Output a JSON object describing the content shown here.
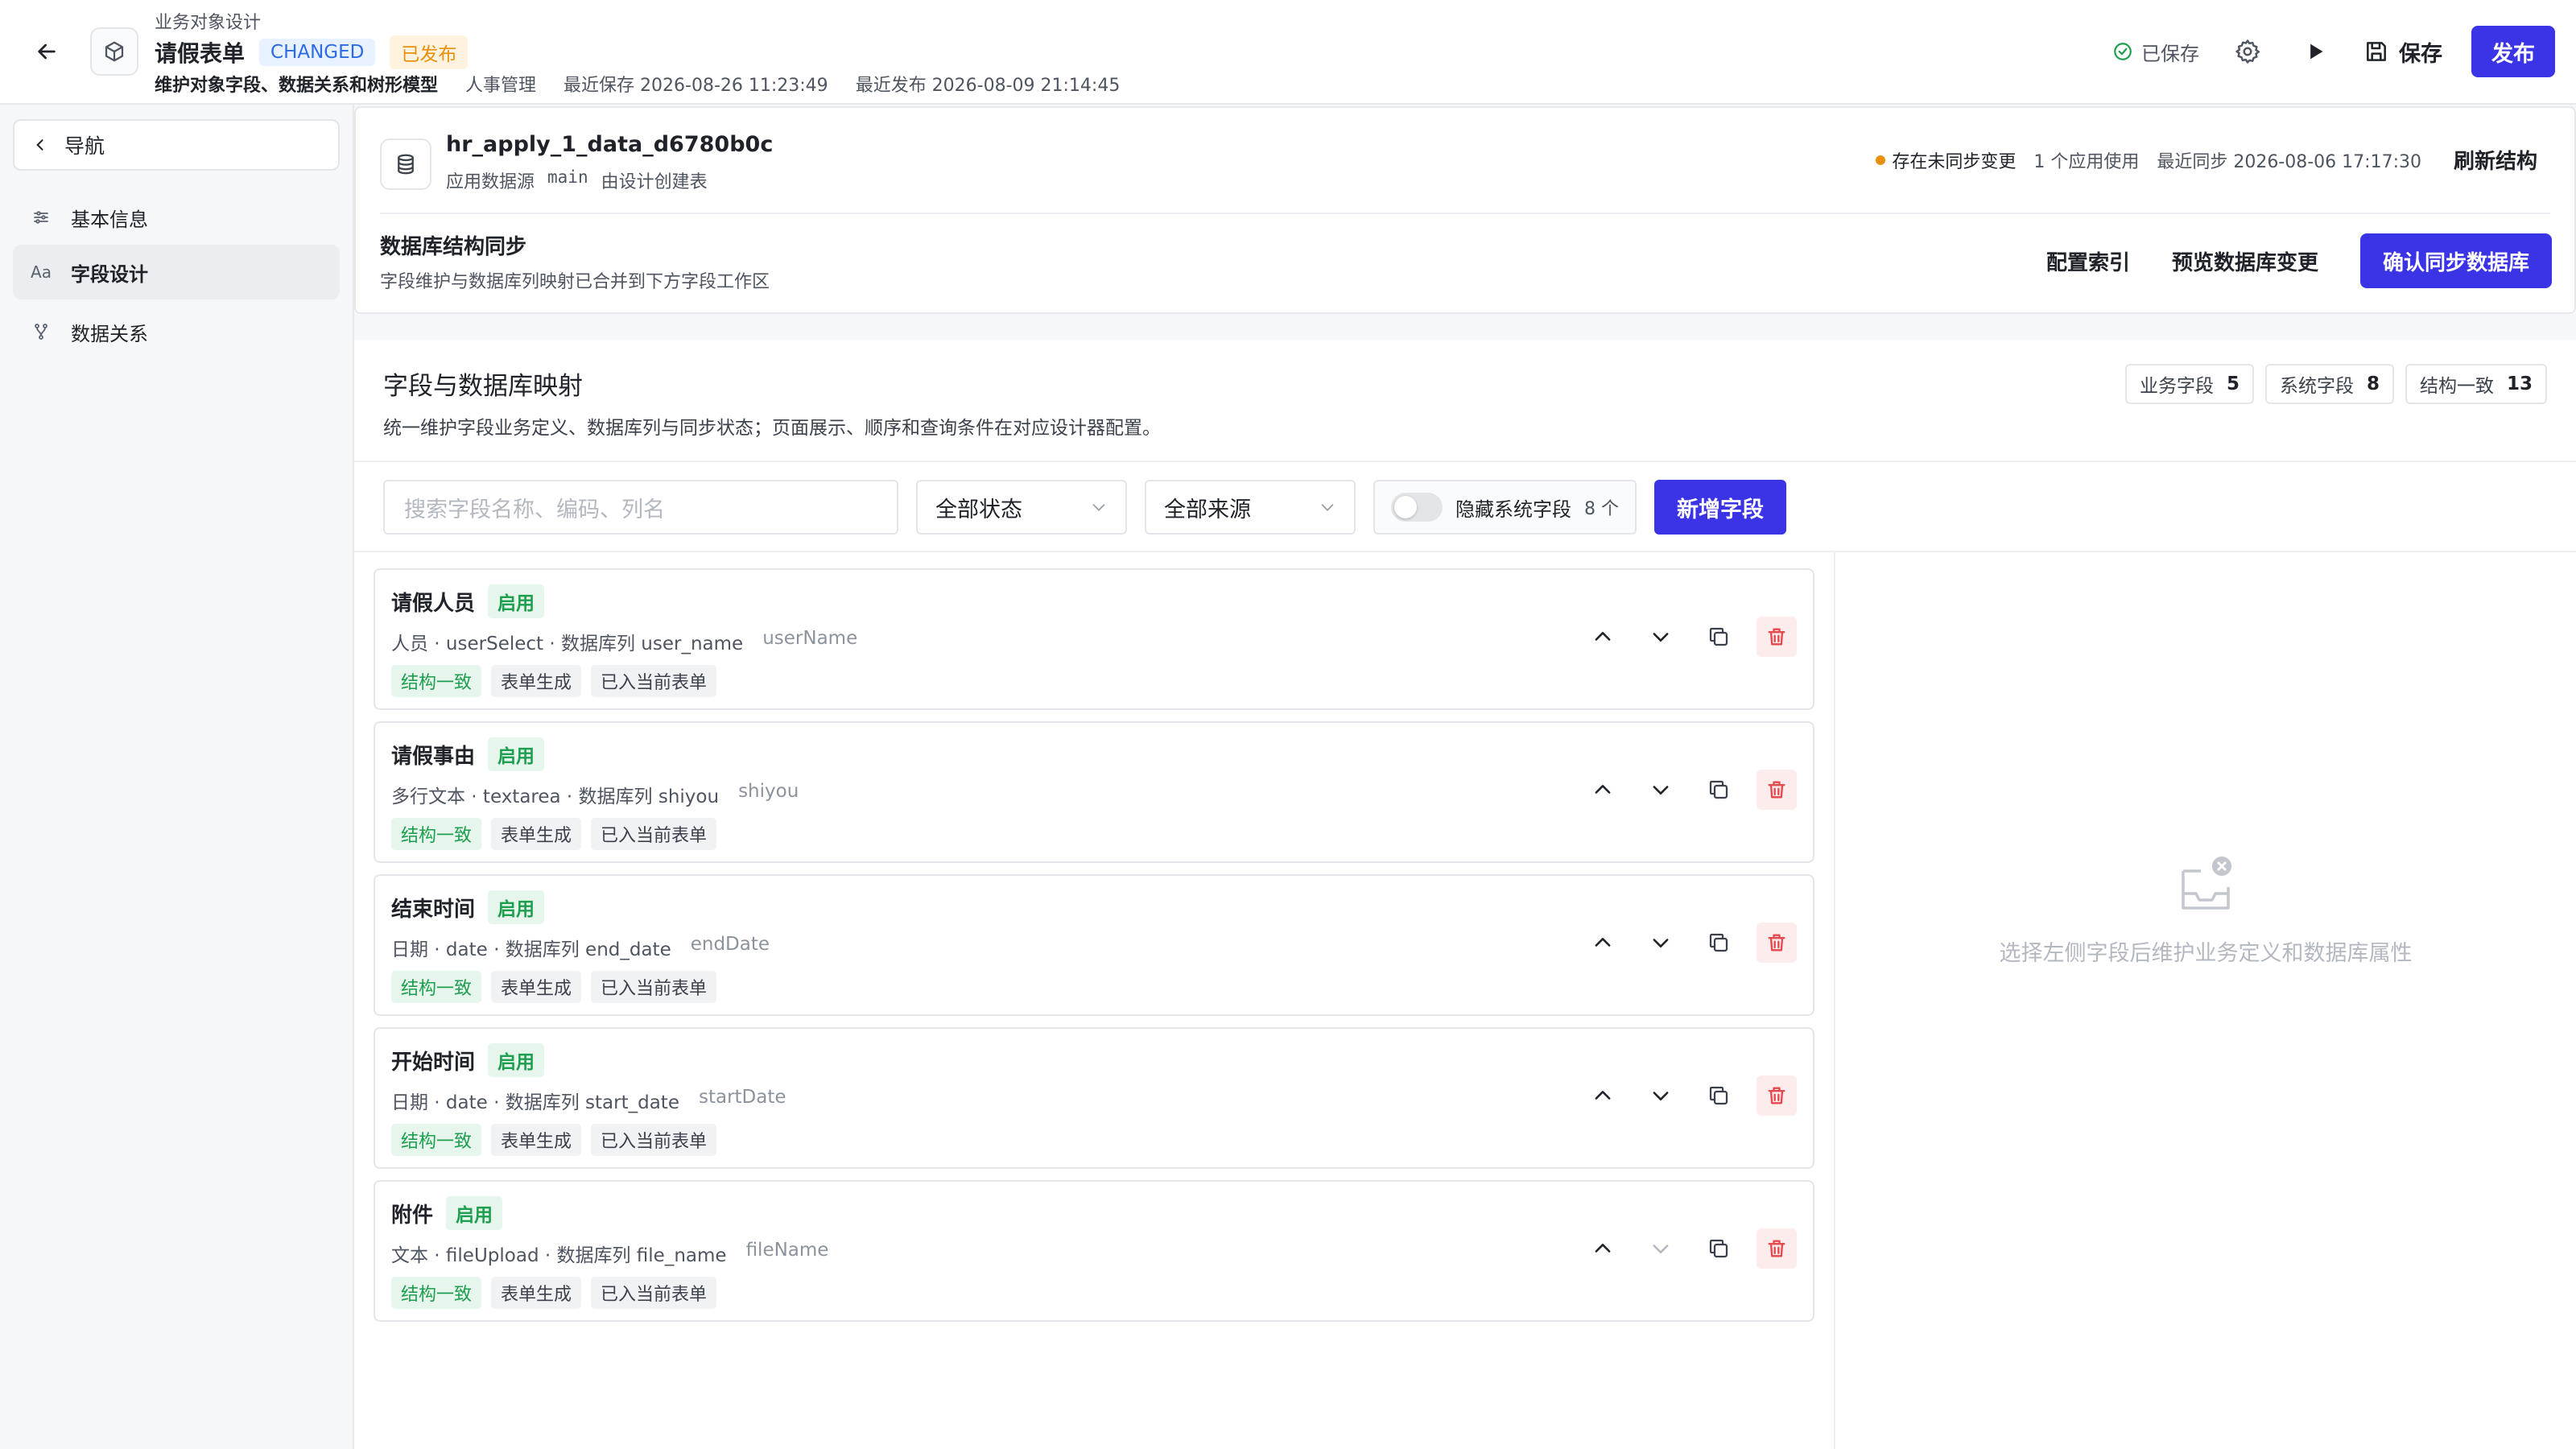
{
  "header": {
    "breadcrumb": "业务对象设计",
    "title": "请假表单",
    "badge_changed": "CHANGED",
    "badge_status": "已发布",
    "subtitle": "维护对象字段、数据关系和树形模型",
    "domain": "人事管理",
    "last_saved": "最近保存 2026-08-26 11:23:49",
    "last_published": "最近发布 2026-08-09 21:14:45",
    "saved_status": "已保存",
    "save_label": "保存",
    "publish_label": "发布"
  },
  "sidebar": {
    "nav_label": "导航",
    "items": [
      {
        "label": "基本信息",
        "icon": "sliders-icon"
      },
      {
        "label": "字段设计",
        "icon": "text-icon",
        "icon_text": "Aa",
        "active": true
      },
      {
        "label": "数据关系",
        "icon": "branch-icon"
      }
    ]
  },
  "db": {
    "table_name": "hr_apply_1_data_d6780b0c",
    "source": "应用数据源",
    "schema": "main",
    "created_by": "由设计创建表",
    "unsynced": "存在未同步变更",
    "app_usage": "1 个应用使用",
    "last_sync": "最近同步 2026-08-06 17:17:30",
    "refresh_label": "刷新结构",
    "sync_title": "数据库结构同步",
    "sync_desc": "字段维护与数据库列映射已合并到下方字段工作区",
    "config_index": "配置索引",
    "preview_changes": "预览数据库变更",
    "confirm_sync": "确认同步数据库"
  },
  "mapping": {
    "title": "字段与数据库映射",
    "desc": "统一维护字段业务定义、数据库列与同步状态；页面展示、顺序和查询条件在对应设计器配置。",
    "counts": [
      {
        "label": "业务字段",
        "value": "5"
      },
      {
        "label": "系统字段",
        "value": "8"
      },
      {
        "label": "结构一致",
        "value": "13"
      }
    ],
    "search_placeholder": "搜索字段名称、编码、列名",
    "status_filter": "全部状态",
    "source_filter": "全部来源",
    "hide_system_label": "隐藏系统字段",
    "hide_system_count": "8 个",
    "add_field_label": "新增字段",
    "empty_text": "选择左侧字段后维护业务定义和数据库属性"
  },
  "fields": [
    {
      "name": "请假人员",
      "status": "启用",
      "meta": "人员 · userSelect · 数据库列 user_name",
      "code": "userName",
      "tags": [
        "结构一致",
        "表单生成",
        "已入当前表单"
      ]
    },
    {
      "name": "请假事由",
      "status": "启用",
      "meta": "多行文本 · textarea · 数据库列 shiyou",
      "code": "shiyou",
      "tags": [
        "结构一致",
        "表单生成",
        "已入当前表单"
      ]
    },
    {
      "name": "结束时间",
      "status": "启用",
      "meta": "日期 · date · 数据库列 end_date",
      "code": "endDate",
      "tags": [
        "结构一致",
        "表单生成",
        "已入当前表单"
      ]
    },
    {
      "name": "开始时间",
      "status": "启用",
      "meta": "日期 · date · 数据库列 start_date",
      "code": "startDate",
      "tags": [
        "结构一致",
        "表单生成",
        "已入当前表单"
      ]
    },
    {
      "name": "附件",
      "status": "启用",
      "meta": "文本 · fileUpload · 数据库列 file_name",
      "code": "fileName",
      "tags": [
        "结构一致",
        "表单生成",
        "已入当前表单"
      ]
    }
  ],
  "colors": {
    "primary": "#3b33e6",
    "success": "#1e9e4f",
    "warning": "#e8900c",
    "danger": "#e5484d",
    "changed": "#2d6be4"
  }
}
